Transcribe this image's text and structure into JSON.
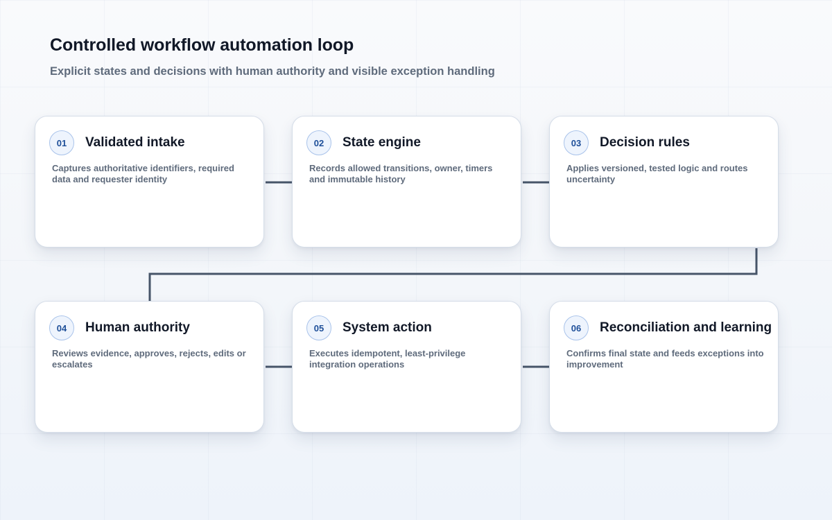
{
  "header": {
    "title": "Controlled workflow automation loop",
    "subtitle": "Explicit states and decisions with human authority and visible exception handling"
  },
  "colors": {
    "connector": "#475569",
    "badge_border": "#a9c3ea",
    "badge_text": "#1e4f99",
    "card_border": "#d5dde8"
  },
  "steps": [
    {
      "number": "01",
      "title": "Validated intake",
      "description": "Captures authoritative identifiers, required data and requester identity"
    },
    {
      "number": "02",
      "title": "State engine",
      "description": "Records allowed transitions, owner, timers and immutable history"
    },
    {
      "number": "03",
      "title": "Decision rules",
      "description": "Applies versioned, tested logic and routes uncertainty"
    },
    {
      "number": "04",
      "title": "Human authority",
      "description": "Reviews evidence, approves, rejects, edits or escalates"
    },
    {
      "number": "05",
      "title": "System action",
      "description": "Executes idempotent, least-privilege integration operations"
    },
    {
      "number": "06",
      "title": "Reconciliation and learning",
      "description": "Confirms final state and feeds exceptions into improvement"
    }
  ]
}
